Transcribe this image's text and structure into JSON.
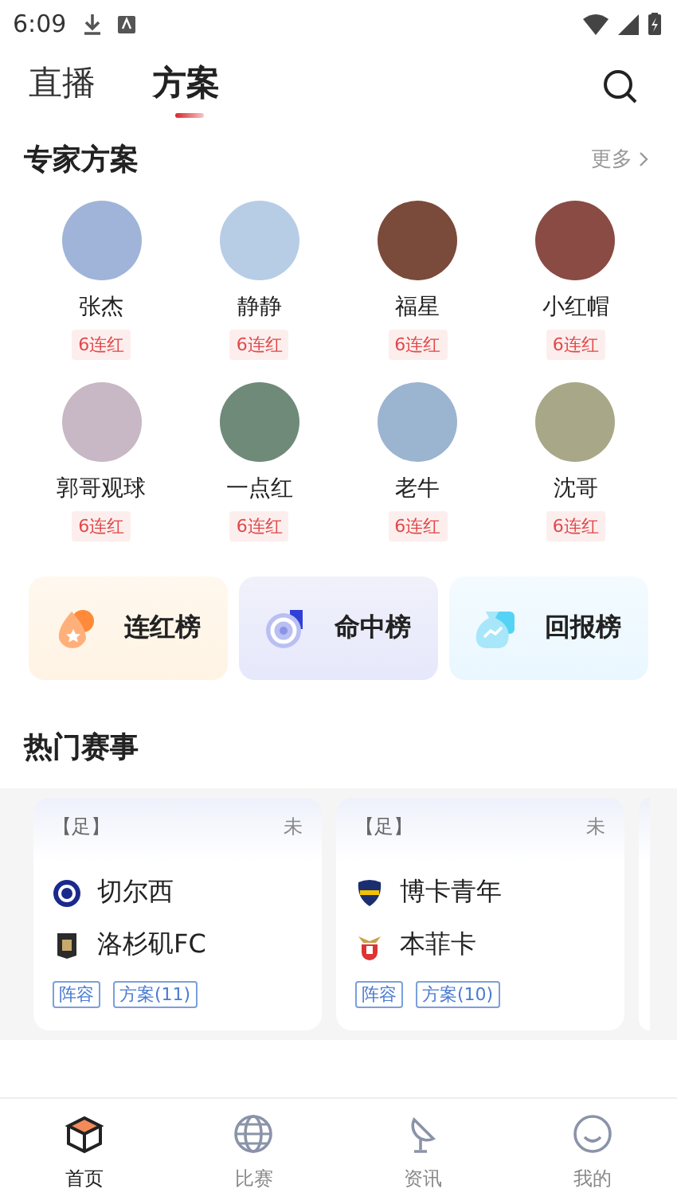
{
  "status_bar": {
    "time": "6:09"
  },
  "tabs": [
    {
      "label": "直播",
      "selected": false
    },
    {
      "label": "方案",
      "selected": true
    }
  ],
  "experts": {
    "title": "专家方案",
    "more": "更多",
    "items": [
      {
        "name": "张杰",
        "badge": "6连红"
      },
      {
        "name": "静静",
        "badge": "6连红"
      },
      {
        "name": "福星",
        "badge": "6连红"
      },
      {
        "name": "小红帽",
        "badge": "6连红"
      },
      {
        "name": "郭哥观球",
        "badge": "6连红"
      },
      {
        "name": "一点红",
        "badge": "6连红"
      },
      {
        "name": "老牛",
        "badge": "6连红"
      },
      {
        "name": "沈哥",
        "badge": "6连红"
      }
    ]
  },
  "rankings": [
    {
      "kind": "streak",
      "label": "连红榜"
    },
    {
      "kind": "hit",
      "label": "命中榜"
    },
    {
      "kind": "return",
      "label": "回报榜"
    }
  ],
  "hot_matches": {
    "title": "热门赛事",
    "matches": [
      {
        "sport": "【足】",
        "status": "未",
        "teams": [
          {
            "kind": "round",
            "name": "切尔西"
          },
          {
            "kind": "square",
            "name": "洛杉矶FC"
          }
        ],
        "tags": [
          "阵容",
          "方案(11)"
        ]
      },
      {
        "sport": "【足】",
        "status": "未",
        "teams": [
          {
            "kind": "shield",
            "name": "博卡青年"
          },
          {
            "kind": "eagle",
            "name": "本菲卡"
          }
        ],
        "tags": [
          "阵容",
          "方案(10)"
        ]
      }
    ]
  },
  "bottom_nav": [
    {
      "kind": "home",
      "label": "首页",
      "selected": true
    },
    {
      "kind": "match",
      "label": "比赛",
      "selected": false
    },
    {
      "kind": "news",
      "label": "资讯",
      "selected": false
    },
    {
      "kind": "me",
      "label": "我的",
      "selected": false
    }
  ]
}
